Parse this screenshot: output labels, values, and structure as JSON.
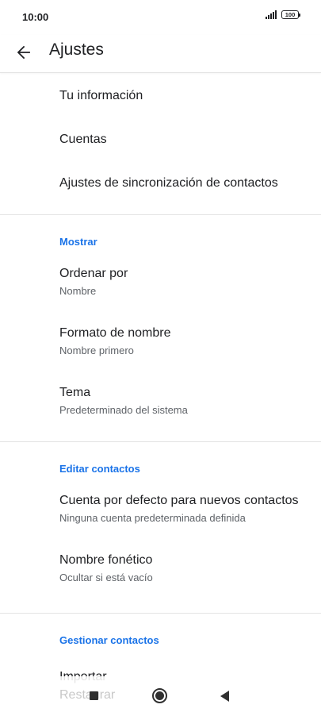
{
  "status_bar": {
    "time": "10:00",
    "battery": "100"
  },
  "app_bar": {
    "title": "Ajustes",
    "back_icon": "arrow-left-icon"
  },
  "general": [
    {
      "title": "Tu información"
    },
    {
      "title": "Cuentas"
    },
    {
      "title": "Ajustes de sincronización de contactos"
    }
  ],
  "sections": [
    {
      "header": "Mostrar",
      "items": [
        {
          "title": "Ordenar por",
          "subtitle": "Nombre"
        },
        {
          "title": "Formato de nombre",
          "subtitle": "Nombre primero"
        },
        {
          "title": "Tema",
          "subtitle": "Predeterminado del sistema"
        }
      ]
    },
    {
      "header": "Editar contactos",
      "items": [
        {
          "title": "Cuenta por defecto para nuevos contactos",
          "subtitle": "Ninguna cuenta predeterminada definida"
        },
        {
          "title": "Nombre fonético",
          "subtitle": "Ocultar si está vacío"
        }
      ]
    },
    {
      "header": "Gestionar contactos",
      "items": [
        {
          "title": "Importar"
        }
      ]
    }
  ],
  "partial_item": "Restaurar",
  "colors": {
    "accent": "#1a73e8",
    "text_primary": "#202124",
    "text_secondary": "#5f6368"
  }
}
